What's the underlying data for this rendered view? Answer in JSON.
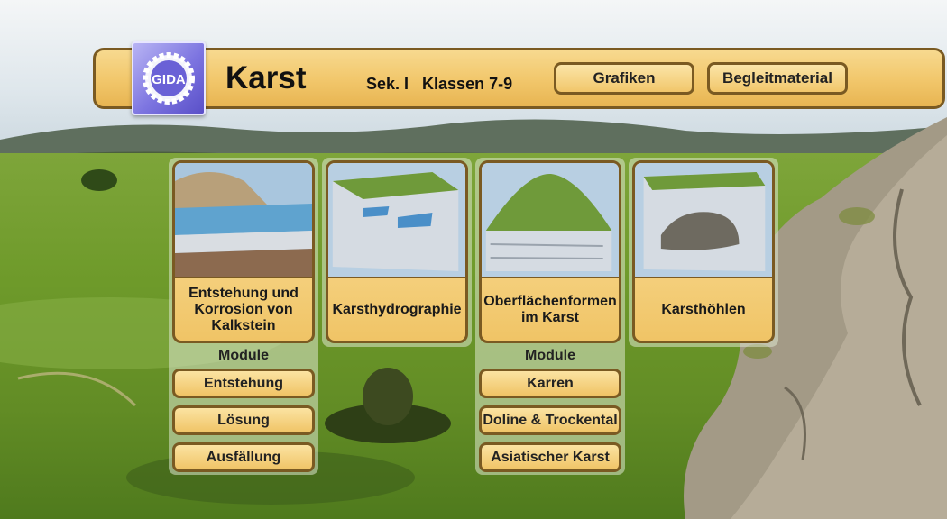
{
  "header": {
    "logo_text": "GIDA",
    "title": "Karst",
    "level": "Sek. I",
    "classes": "Klassen 7-9",
    "buttons": [
      "Grafiken",
      "Begleitmaterial"
    ]
  },
  "topics": [
    {
      "label": "Entstehung und Korrosion von Kalkstein"
    },
    {
      "label": "Karsthydrographie"
    },
    {
      "label": "Oberflächenformen im Karst"
    },
    {
      "label": "Karsthöhlen"
    }
  ],
  "modules_left": {
    "title": "Module",
    "items": [
      "Entstehung",
      "Lösung",
      "Ausfällung"
    ]
  },
  "modules_right": {
    "title": "Module",
    "items": [
      "Karren",
      "Doline & Trockental",
      "Asiatischer Karst"
    ]
  }
}
